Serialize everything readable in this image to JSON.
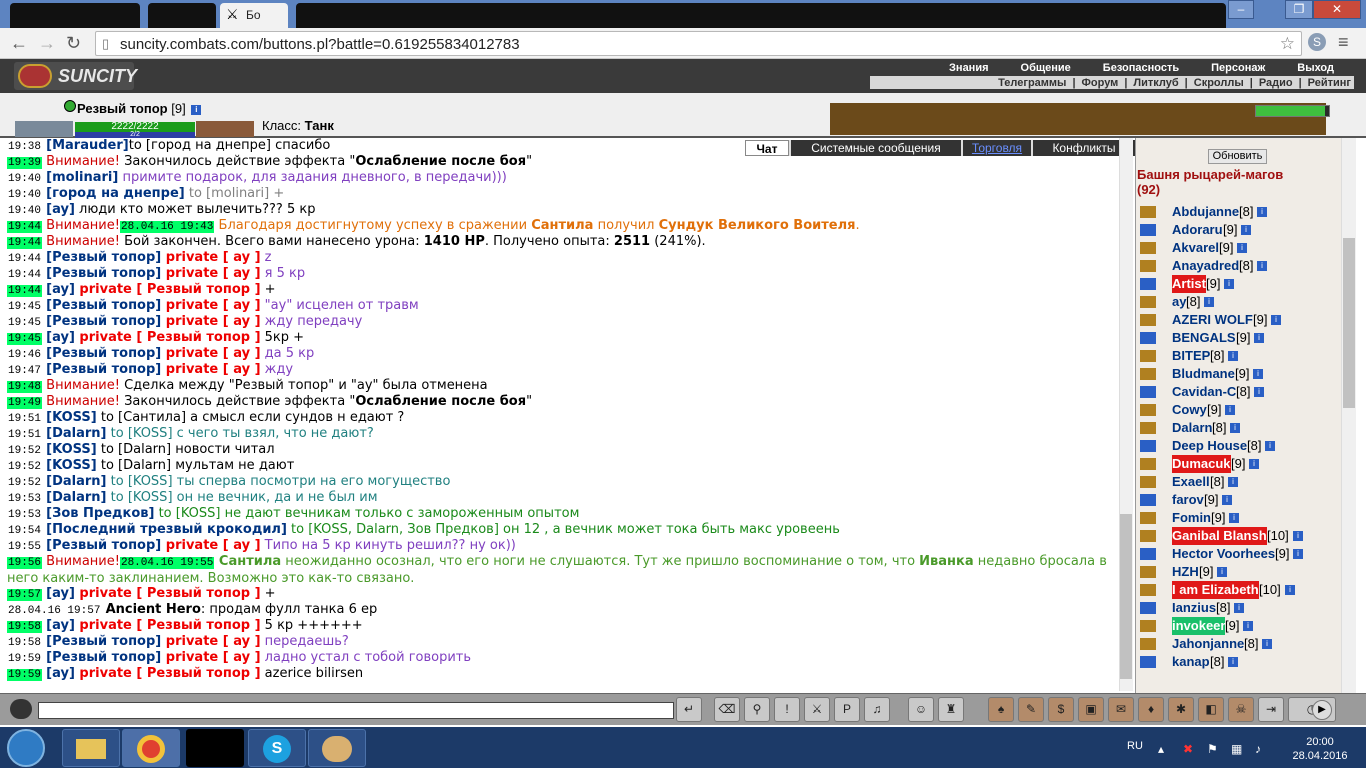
{
  "browser": {
    "tab_title": "Бо",
    "url": "suncity.combats.com/buttons.pl?battle=0.619255834012783"
  },
  "game": {
    "logo": "SUNCITY",
    "menu_top": [
      "Знания",
      "Общение",
      "Безопасность",
      "Персонаж",
      "Выход"
    ],
    "menu_bottom": [
      "Телеграммы",
      "|",
      "Форум",
      "|",
      "Литклуб",
      "|",
      "Скроллы",
      "|",
      "Радио",
      "|",
      "Рейтинг"
    ],
    "char_name": "Резвый топор",
    "char_level": "[9]",
    "hp": "2222/2222",
    "mp": "2/2",
    "class_label": "Класс:",
    "class_value": "Танк"
  },
  "chat_tabs": [
    "Чат",
    "Системные сообщения",
    "Торговля",
    "Конфликты"
  ],
  "chat": [
    {
      "t": "19:38",
      "hi": false,
      "parts": [
        [
          "nick",
          "[Marauder]"
        ],
        [
          "",
          "to [город на днепре] спасибо"
        ]
      ]
    },
    {
      "t": "19:39",
      "hi": true,
      "parts": [
        [
          "warn",
          "Внимание!"
        ],
        [
          "",
          " Закончилось действие эффекта \""
        ],
        [
          "b",
          "Ослабление после боя"
        ],
        [
          "",
          "\""
        ]
      ]
    },
    {
      "t": "19:40",
      "hi": false,
      "parts": [
        [
          "nick",
          "[molinari]"
        ],
        [
          "purple",
          " примите подарок, для задания дневного, в передачи)))"
        ]
      ]
    },
    {
      "t": "19:40",
      "hi": false,
      "parts": [
        [
          "nick",
          "[город на днепре]"
        ],
        [
          "gray",
          " to [molinari] +"
        ]
      ]
    },
    {
      "t": "19:40",
      "hi": false,
      "parts": [
        [
          "nick",
          "[ay]"
        ],
        [
          "",
          " люди кто может вылечить??? 5 кр"
        ]
      ]
    },
    {
      "t": "19:44",
      "hi": true,
      "parts": [
        [
          "warn",
          "Внимание!"
        ],
        [
          "ts hi",
          "28.04.16 19:43"
        ],
        [
          "orange",
          " Благодаря достигнутому успеху в сражении "
        ],
        [
          "orange b",
          "Сантила"
        ],
        [
          "orange",
          " получил "
        ],
        [
          "orange b",
          "Сундук Великого Воителя"
        ],
        [
          "orange",
          "."
        ]
      ]
    },
    {
      "t": "19:44",
      "hi": true,
      "parts": [
        [
          "warn",
          "Внимание!"
        ],
        [
          "",
          " Бой закончен. Всего вами нанесено урона: "
        ],
        [
          "b",
          "1410 HP"
        ],
        [
          "",
          ". Получено опыта: "
        ],
        [
          "b",
          "2511"
        ],
        [
          "",
          " (241%)."
        ]
      ]
    },
    {
      "t": "19:44",
      "hi": false,
      "parts": [
        [
          "nick",
          "[Резвый топор]"
        ],
        [
          "priv",
          " private [ ay ]"
        ],
        [
          "purple",
          " z"
        ]
      ]
    },
    {
      "t": "19:44",
      "hi": false,
      "parts": [
        [
          "nick",
          "[Резвый топор]"
        ],
        [
          "priv",
          " private [ ay ]"
        ],
        [
          "purple",
          " я 5 кр"
        ]
      ]
    },
    {
      "t": "19:44",
      "hi": true,
      "parts": [
        [
          "nick",
          "[ay]"
        ],
        [
          "priv",
          " private [ Резвый топор ]"
        ],
        [
          "",
          " +"
        ]
      ]
    },
    {
      "t": "19:45",
      "hi": false,
      "parts": [
        [
          "nick",
          "[Резвый топор]"
        ],
        [
          "priv",
          " private [ ay ]"
        ],
        [
          "purple",
          " \"ay\" исцелен от травм"
        ]
      ]
    },
    {
      "t": "19:45",
      "hi": false,
      "parts": [
        [
          "nick",
          "[Резвый топор]"
        ],
        [
          "priv",
          " private [ ay ]"
        ],
        [
          "purple",
          " жду передачу"
        ]
      ]
    },
    {
      "t": "19:45",
      "hi": true,
      "parts": [
        [
          "nick",
          "[ay]"
        ],
        [
          "priv",
          " private [ Резвый топор ]"
        ],
        [
          "",
          " 5кр +"
        ]
      ]
    },
    {
      "t": "19:46",
      "hi": false,
      "parts": [
        [
          "nick",
          "[Резвый топор]"
        ],
        [
          "priv",
          " private [ ay ]"
        ],
        [
          "purple",
          " да 5 кр"
        ]
      ]
    },
    {
      "t": "19:47",
      "hi": false,
      "parts": [
        [
          "nick",
          "[Резвый топор]"
        ],
        [
          "priv",
          " private [ ay ]"
        ],
        [
          "purple",
          " жду"
        ]
      ]
    },
    {
      "t": "19:48",
      "hi": true,
      "parts": [
        [
          "warn",
          "Внимание!"
        ],
        [
          "",
          " Сделка между \"Резвый топор\" и \"ay\" была отменена"
        ]
      ]
    },
    {
      "t": "19:49",
      "hi": true,
      "parts": [
        [
          "warn",
          "Внимание!"
        ],
        [
          "",
          " Закончилось действие эффекта \""
        ],
        [
          "b",
          "Ослабление после боя"
        ],
        [
          "",
          "\""
        ]
      ]
    },
    {
      "t": "19:51",
      "hi": false,
      "parts": [
        [
          "nick",
          "[KOSS]"
        ],
        [
          "",
          " to [Сантила] а смысл если сундов н едают ?"
        ]
      ]
    },
    {
      "t": "19:51",
      "hi": false,
      "parts": [
        [
          "nick",
          "[Dalarn]"
        ],
        [
          "teal",
          " to [KOSS] с чего ты взял, что не дают?"
        ]
      ]
    },
    {
      "t": "19:52",
      "hi": false,
      "parts": [
        [
          "nick",
          "[KOSS]"
        ],
        [
          "",
          " to [Dalarn] новости читал"
        ]
      ]
    },
    {
      "t": "19:52",
      "hi": false,
      "parts": [
        [
          "nick",
          "[KOSS]"
        ],
        [
          "",
          " to [Dalarn] мультам не дают"
        ]
      ]
    },
    {
      "t": "19:52",
      "hi": false,
      "parts": [
        [
          "nick",
          "[Dalarn]"
        ],
        [
          "teal",
          " to [KOSS] ты сперва посмотри на его могущество"
        ]
      ]
    },
    {
      "t": "19:53",
      "hi": false,
      "parts": [
        [
          "nick",
          "[Dalarn]"
        ],
        [
          "teal",
          " to [KOSS] он не вечник, да и не был им"
        ]
      ]
    },
    {
      "t": "19:53",
      "hi": false,
      "parts": [
        [
          "nick",
          "[Зов Предков]"
        ],
        [
          "grn",
          " to [KOSS] не дают вечникам только с замороженным опытом"
        ]
      ]
    },
    {
      "t": "19:54",
      "hi": false,
      "parts": [
        [
          "nick",
          "[Последний трезвый крокодил]"
        ],
        [
          "grn",
          " to [KOSS, Dalarn, Зов Предков] он 12 , а вечник может тока быть макс уровеень"
        ]
      ]
    },
    {
      "t": "19:55",
      "hi": false,
      "parts": [
        [
          "nick",
          "[Резвый топор]"
        ],
        [
          "priv",
          " private [ ay ]"
        ],
        [
          "purple",
          " Типо на 5 кр кинуть решил?? ну ок))"
        ]
      ]
    },
    {
      "t": "19:56",
      "hi": true,
      "wrap": true,
      "parts": [
        [
          "warn",
          "Внимание!"
        ],
        [
          "ts hi",
          "28.04.16 19:55"
        ],
        [
          "grn2 b",
          " Сантила"
        ],
        [
          "grn2",
          " неожиданно осознал, что его ноги не слушаются. Тут же пришло воспоминание о том, что "
        ],
        [
          "grn2 b",
          "Иванка"
        ],
        [
          "grn2",
          " недавно бросала в него каким-то заклинанием. Возможно это как-то связано."
        ]
      ]
    },
    {
      "t": "19:57",
      "hi": true,
      "parts": [
        [
          "nick",
          "[ay]"
        ],
        [
          "priv",
          " private [ Резвый топор ]"
        ],
        [
          "",
          " +"
        ]
      ]
    },
    {
      "t": "28.04.16 19:57",
      "hi": false,
      "parts": [
        [
          "b",
          "Ancient Hero"
        ],
        [
          "",
          ": продам фулл танка 6 ер"
        ]
      ]
    },
    {
      "t": "19:58",
      "hi": true,
      "parts": [
        [
          "nick",
          "[ay]"
        ],
        [
          "priv",
          " private [ Резвый топор ]"
        ],
        [
          "",
          " 5 кр ++++++"
        ]
      ]
    },
    {
      "t": "19:58",
      "hi": false,
      "parts": [
        [
          "nick",
          "[Резвый топор]"
        ],
        [
          "priv",
          " private [ ay ]"
        ],
        [
          "purple",
          " передаешь?"
        ]
      ]
    },
    {
      "t": "19:59",
      "hi": false,
      "parts": [
        [
          "nick",
          "[Резвый топор]"
        ],
        [
          "priv",
          " private [ ay ]"
        ],
        [
          "purple",
          " ладно устал с тобой говорить"
        ]
      ]
    },
    {
      "t": "19:59",
      "hi": true,
      "parts": [
        [
          "nick",
          "[ay]"
        ],
        [
          "priv",
          " private [ Резвый топор ]"
        ],
        [
          "",
          " azerice bilirsen"
        ]
      ]
    }
  ],
  "room": {
    "refresh_label": "Обновить",
    "name": "Башня рыцарей-магов",
    "count": "(92)",
    "users": [
      {
        "name": "Abdujanne",
        "lvl": "[8]",
        "hl": ""
      },
      {
        "name": "Adoraru",
        "lvl": "[9]",
        "hl": ""
      },
      {
        "name": "Akvarel",
        "lvl": "[9]",
        "hl": ""
      },
      {
        "name": "Anayadred",
        "lvl": "[8]",
        "hl": ""
      },
      {
        "name": "Artist",
        "lvl": "[9]",
        "hl": "red"
      },
      {
        "name": "ay",
        "lvl": "[8]",
        "hl": ""
      },
      {
        "name": "AZERI WOLF",
        "lvl": "[9]",
        "hl": ""
      },
      {
        "name": "BENGALS",
        "lvl": "[9]",
        "hl": ""
      },
      {
        "name": "BITEP",
        "lvl": "[8]",
        "hl": ""
      },
      {
        "name": "Bludmane",
        "lvl": "[9]",
        "hl": ""
      },
      {
        "name": "Cavidan-C",
        "lvl": "[8]",
        "hl": ""
      },
      {
        "name": "Cowy",
        "lvl": "[9]",
        "hl": ""
      },
      {
        "name": "Dalarn",
        "lvl": "[8]",
        "hl": ""
      },
      {
        "name": "Deep House",
        "lvl": "[8]",
        "hl": ""
      },
      {
        "name": "Dumacuk",
        "lvl": "[9]",
        "hl": "red"
      },
      {
        "name": "Exaell",
        "lvl": "[8]",
        "hl": ""
      },
      {
        "name": "farov",
        "lvl": "[9]",
        "hl": ""
      },
      {
        "name": "Fomin",
        "lvl": "[9]",
        "hl": ""
      },
      {
        "name": "Ganibal Blansh",
        "lvl": "[10]",
        "hl": "red"
      },
      {
        "name": "Hector Voorhees",
        "lvl": "[9]",
        "hl": ""
      },
      {
        "name": "HZH",
        "lvl": "[9]",
        "hl": ""
      },
      {
        "name": "I am Elizabeth",
        "lvl": "[10]",
        "hl": "red"
      },
      {
        "name": "Ianzius",
        "lvl": "[8]",
        "hl": ""
      },
      {
        "name": "invokeer",
        "lvl": "[9]",
        "hl": "green"
      },
      {
        "name": "Jahonjanne",
        "lvl": "[8]",
        "hl": ""
      },
      {
        "name": "kanap",
        "lvl": "[8]",
        "hl": ""
      }
    ]
  },
  "taskbar": {
    "lang": "RU",
    "time": "20:00",
    "date": "28.04.2016"
  },
  "colors": {
    "accent": "#5d84c1",
    "private": "#ee0000",
    "highlight_time": "#00ff66"
  }
}
